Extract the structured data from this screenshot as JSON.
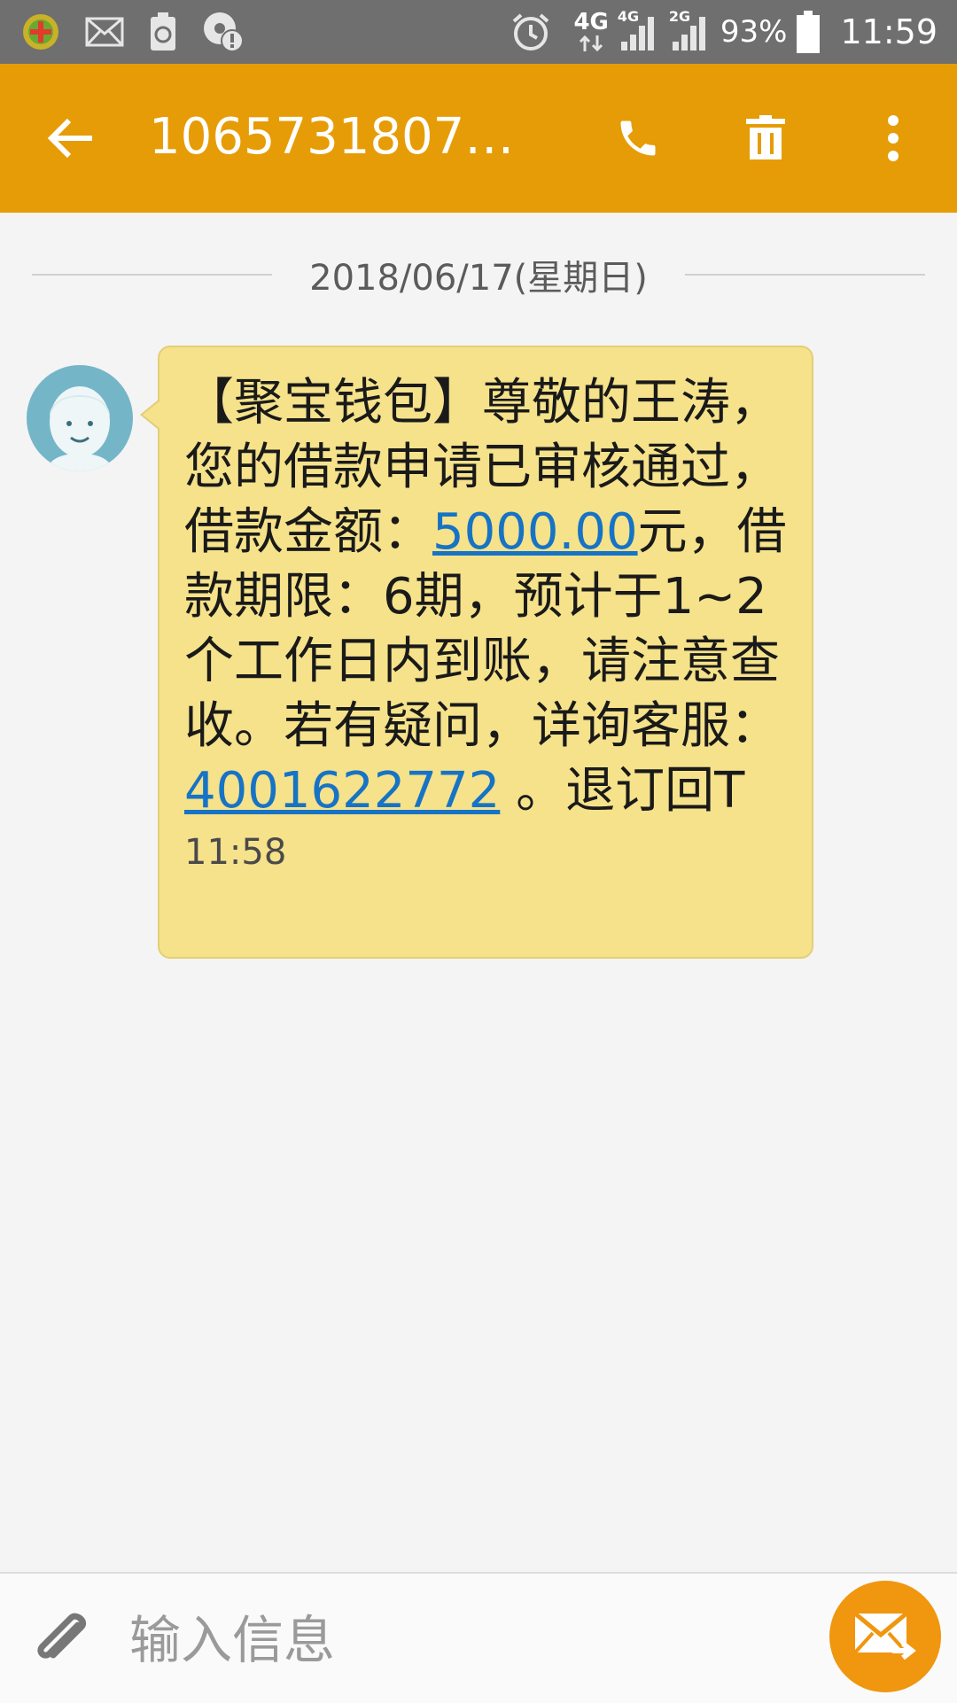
{
  "status_bar": {
    "network_4g": "4G",
    "signal_4g": "4G",
    "signal_2g": "2G",
    "battery_percent": "93%",
    "time": "11:59"
  },
  "header": {
    "title": "10657318076...",
    "color": "#e69c06"
  },
  "conversation": {
    "date": "2018/06/17(星期日)",
    "message": {
      "text_part1": "【聚宝钱包】尊敬的王涛，您的借款申请已审核通过，借款金额：",
      "amount_link": "5000.00",
      "text_part2": "元，借款期限：6期，预计于1~2个工作日内到账，请注意查收。若有疑问，详询客服：",
      "phone_link": "4001622772",
      "text_part3": " 。退订回T",
      "time": "11:58",
      "bubble_color": "#f5e28a"
    }
  },
  "composer": {
    "placeholder": "输入信息",
    "send_color": "#f0960f"
  }
}
